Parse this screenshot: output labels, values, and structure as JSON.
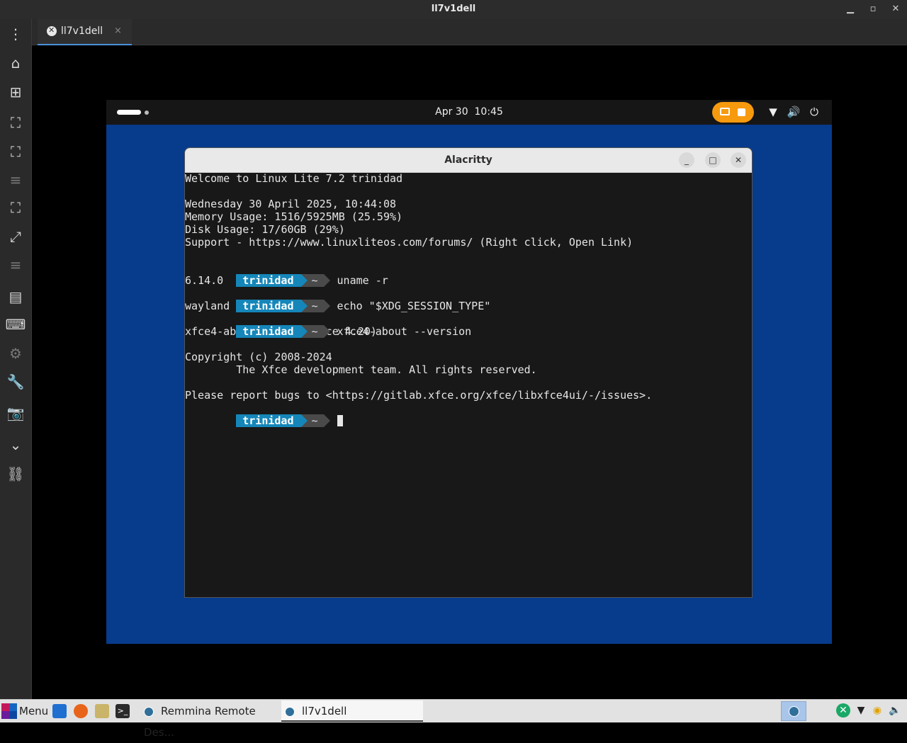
{
  "window": {
    "title": "ll7v1dell"
  },
  "tab": {
    "label": "ll7v1dell",
    "close": "×"
  },
  "remote": {
    "topbar": {
      "date": "Apr 30",
      "time": "10:45"
    },
    "terminal": {
      "title": "Alacritty",
      "prompt_user": "trinidad",
      "prompt_dir": "~",
      "lines": {
        "welcome": "Welcome to Linux Lite 7.2 trinidad",
        "date": "Wednesday 30 April 2025, 10:44:08",
        "memory": "Memory Usage: 1516/5925MB (25.59%)",
        "disk": "Disk Usage: 17/60GB (29%)",
        "support": "Support - https://www.linuxliteos.com/forums/ (Right click, Open Link)",
        "cmd1": "uname -r",
        "out1": "6.14.0",
        "cmd2": "echo \"$XDG_SESSION_TYPE\"",
        "out2": "wayland",
        "cmd3": "xfce4-about --version",
        "out3": "xfce4-about 4.20.0 (Xfce 4.20)",
        "copyright": "Copyright (c) 2008-2024",
        "team": "        The Xfce development team. All rights reserved.",
        "bugs": "Please report bugs to <https://gitlab.xfce.org/xfce/libxfce4ui/-/issues>."
      }
    }
  },
  "taskbar": {
    "menu_label": "Menu",
    "tasks": [
      {
        "label": "Remmina Remote Des..."
      },
      {
        "label": "ll7v1dell"
      }
    ]
  },
  "colors": {
    "remote_bg": "#073b8c",
    "prompt_user_bg": "#1586b9",
    "recording_pill": "#f79a0e"
  }
}
